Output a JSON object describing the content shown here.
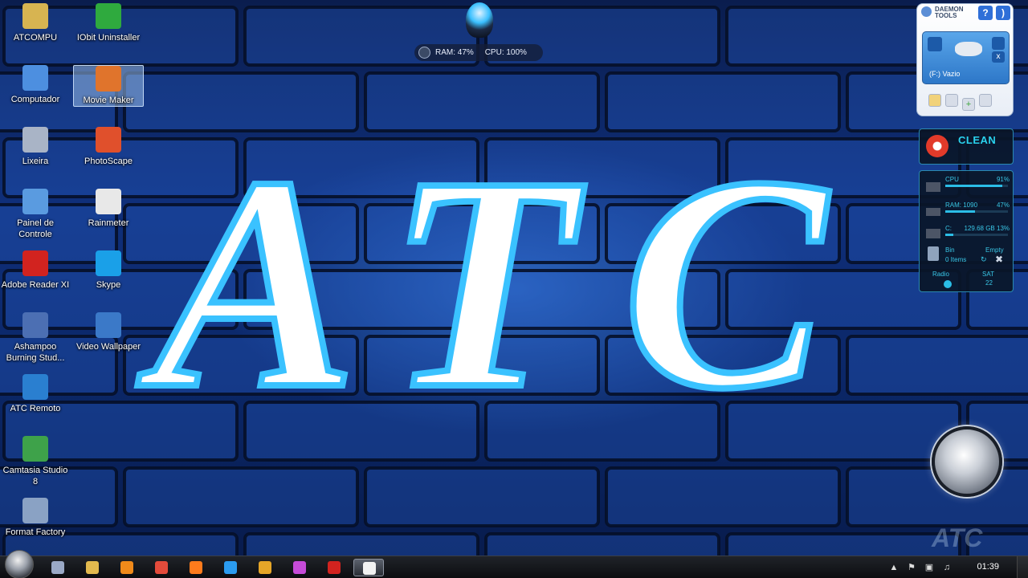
{
  "desktop_icons": [
    {
      "label": "ATCOMPU",
      "icon": "folder-icon",
      "color": "#d7b451"
    },
    {
      "label": "IObit Uninstaller",
      "icon": "iobit-uninstaller-icon",
      "color": "#2faa3e"
    },
    {
      "label": "Computador",
      "icon": "computer-icon",
      "color": "#4d8fe0"
    },
    {
      "label": "Movie Maker",
      "icon": "movie-maker-icon",
      "color": "#e0742c"
    },
    {
      "label": "Lixeira",
      "icon": "recycle-bin-icon",
      "color": "#a9b4c6"
    },
    {
      "label": "PhotoScape",
      "icon": "photoscape-icon",
      "color": "#e0502c"
    },
    {
      "label": "Painel de Controle",
      "icon": "control-panel-icon",
      "color": "#5a9be0"
    },
    {
      "label": "Rainmeter",
      "icon": "rainmeter-icon",
      "color": "#e8e8e8"
    },
    {
      "label": "Adobe Reader XI",
      "icon": "adobe-reader-icon",
      "color": "#d2231f"
    },
    {
      "label": "Skype",
      "icon": "skype-icon",
      "color": "#1aa0e8"
    },
    {
      "label": "Ashampoo Burning Stud...",
      "icon": "ashampoo-burning-icon",
      "color": "#4c6fb3"
    },
    {
      "label": "Video Wallpaper",
      "icon": "video-wallpaper-icon",
      "color": "#3b79c8"
    },
    {
      "label": "ATC Remoto",
      "icon": "atc-remoto-icon",
      "color": "#2a7fd0"
    },
    {
      "label": "Camtasia Studio 8",
      "icon": "camtasia-icon",
      "color": "#3ea24a"
    },
    {
      "label": "Format Factory",
      "icon": "format-factory-icon",
      "color": "#8aa2c4"
    }
  ],
  "sysbar": {
    "ram": "RAM: 47%",
    "cpu": "CPU: 100%"
  },
  "daemon": {
    "title_line1": "DAEMON",
    "title_line2": "TOOLS",
    "help": "?",
    "drive_label": "(F:) Vazio"
  },
  "clean": {
    "label": "CLEAN"
  },
  "monitor": {
    "cpu_label": "CPU",
    "cpu_value": "91%",
    "cpu_fill": 0.91,
    "ram_label": "RAM: 1090",
    "ram_value": "47%",
    "ram_fill": 0.47,
    "disk_label": "C:",
    "disk_value": "129.68 GB 13%",
    "disk_fill": 0.13,
    "bin_label": "Bin",
    "bin_state": "Empty",
    "bin_items": "0 Items",
    "radio_label": "Radio",
    "day": "SAT",
    "date": "22"
  },
  "watermark": "ATC",
  "wallpaper_text": "ATC",
  "taskbar": {
    "pinned": [
      {
        "icon": "network-icon",
        "color": "#9aa9c6"
      },
      {
        "icon": "explorer-icon",
        "color": "#e2b94e"
      },
      {
        "icon": "media-player-icon",
        "color": "#f08a1a"
      },
      {
        "icon": "chrome-icon",
        "color": "#e44b3b"
      },
      {
        "icon": "firefox-icon",
        "color": "#ff7b1c"
      },
      {
        "icon": "ie-icon",
        "color": "#2b9cf0"
      },
      {
        "icon": "package-icon",
        "color": "#e6a628"
      },
      {
        "icon": "photoscape-icon",
        "color": "#c64bd8"
      },
      {
        "icon": "acrobat-icon",
        "color": "#d2231f"
      },
      {
        "icon": "camtasia-icon",
        "color": "#f2f2f2"
      }
    ],
    "clock": "01:39"
  }
}
